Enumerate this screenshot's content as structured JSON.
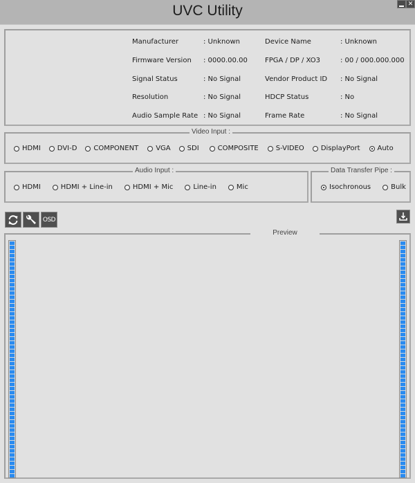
{
  "window": {
    "title": "UVC Utility",
    "minimize_icon": "minimize-icon",
    "close_icon": "close-icon"
  },
  "device_info": {
    "left": [
      {
        "label": "Manufacturer",
        "value": ": Unknown"
      },
      {
        "label": "Firmware Version",
        "value": ": 0000.00.00"
      },
      {
        "label": "Signal Status",
        "value": ": No Signal"
      },
      {
        "label": "Resolution",
        "value": ": No Signal"
      },
      {
        "label": "Audio Sample Rate",
        "value": ": No Signal"
      }
    ],
    "right": [
      {
        "label": "Device Name",
        "value": ": Unknown"
      },
      {
        "label": "FPGA / DP / XO3",
        "value": ": 00 / 000.000.000"
      },
      {
        "label": "Vendor  Product ID",
        "value": ": No Signal"
      },
      {
        "label": "HDCP Status",
        "value": ": No"
      },
      {
        "label": "Frame Rate",
        "value": ": No Signal"
      }
    ]
  },
  "video_input": {
    "legend": "Video Input :",
    "options": [
      {
        "label": "HDMI",
        "selected": false
      },
      {
        "label": "DVI-D",
        "selected": false
      },
      {
        "label": "COMPONENT",
        "selected": false
      },
      {
        "label": "VGA",
        "selected": false
      },
      {
        "label": "SDI",
        "selected": false
      },
      {
        "label": "COMPOSITE",
        "selected": false
      },
      {
        "label": "S-VIDEO",
        "selected": false
      },
      {
        "label": "DisplayPort",
        "selected": false
      },
      {
        "label": "Auto",
        "selected": true
      }
    ]
  },
  "audio_input": {
    "legend": "Audio Input :",
    "options": [
      {
        "label": "HDMI",
        "selected": false
      },
      {
        "label": "HDMI + Line-in",
        "selected": false
      },
      {
        "label": "HDMI + Mic",
        "selected": false
      },
      {
        "label": "Line-in",
        "selected": false
      },
      {
        "label": "Mic",
        "selected": false
      }
    ]
  },
  "data_transfer_pipe": {
    "legend": "Data Transfer Pipe :",
    "options": [
      {
        "label": "Isochronous",
        "selected": true
      },
      {
        "label": "Bulk",
        "selected": false
      }
    ]
  },
  "toolbar": {
    "refresh_icon": "refresh-icon",
    "settings_icon": "wrench-icon",
    "osd_label": "OSD",
    "download_icon": "download-icon"
  },
  "preview": {
    "legend": "Preview",
    "left_meter_level": 1.0,
    "right_meter_level": 1.0,
    "meter_color": "#2a8bf0"
  }
}
